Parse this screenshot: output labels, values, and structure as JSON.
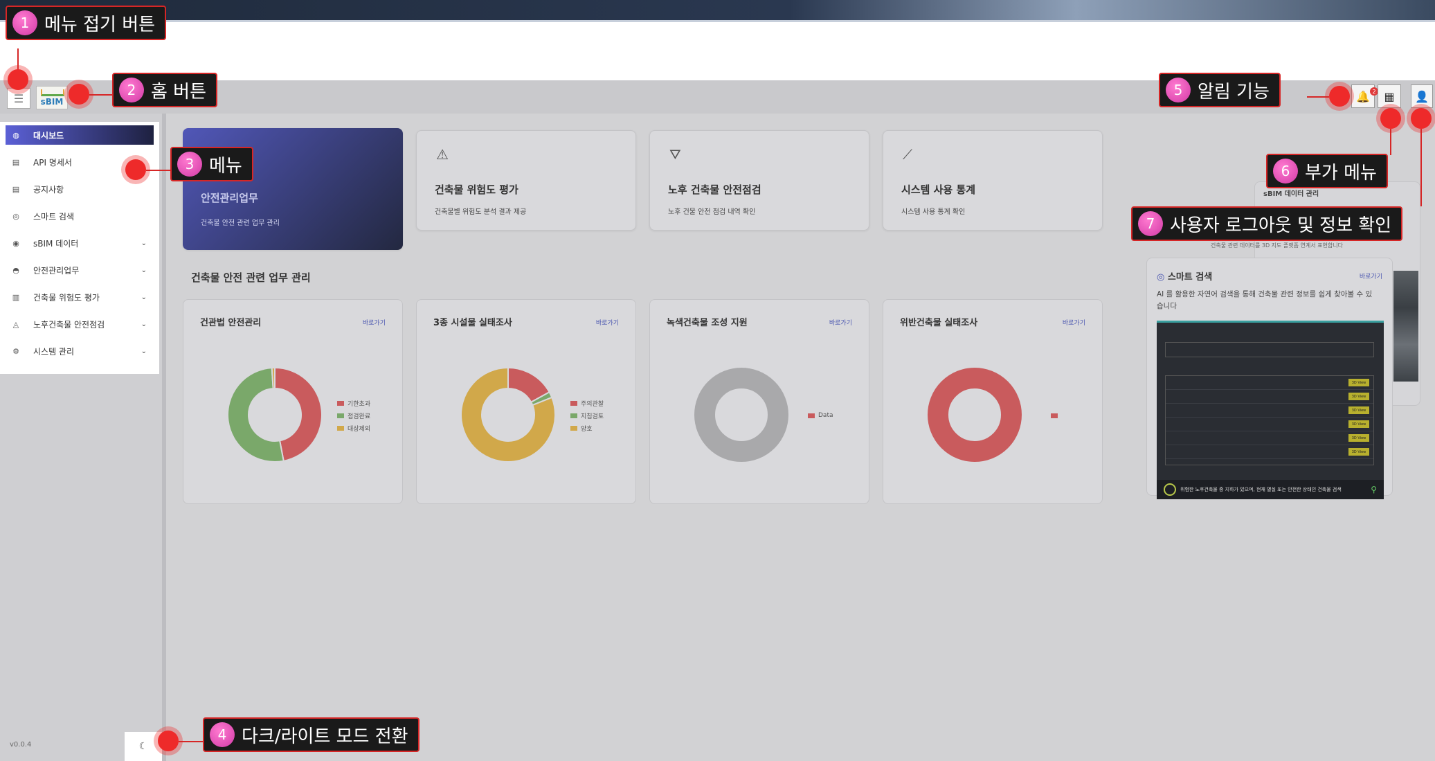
{
  "header": {
    "menu_toggle_glyph": "☰",
    "logo_text": "sBIM",
    "notification_count": "2",
    "grid_glyph": "▦",
    "user_glyph": "👤"
  },
  "sidebar": {
    "items": [
      {
        "label": "대시보드",
        "icon": "dashboard-icon",
        "glyph": "◍"
      },
      {
        "label": "API 명세서",
        "icon": "document-icon",
        "glyph": "▤"
      },
      {
        "label": "공지사항",
        "icon": "notice-icon",
        "glyph": "▤"
      },
      {
        "label": "스마트 검색",
        "icon": "globe-icon",
        "glyph": "◎"
      },
      {
        "label": "sBIM 데이터",
        "icon": "scan-icon",
        "glyph": "◉",
        "chevron": "⌄"
      },
      {
        "label": "안전관리업무",
        "icon": "helmet-icon",
        "glyph": "◓",
        "chevron": "⌄"
      },
      {
        "label": "건축물 위험도 평가",
        "icon": "building-chart-icon",
        "glyph": "▥",
        "chevron": "⌄"
      },
      {
        "label": "노후건축물 안전점검",
        "icon": "inspection-icon",
        "glyph": "◬",
        "chevron": "⌄"
      },
      {
        "label": "시스템 관리",
        "icon": "settings-icon",
        "glyph": "⚙",
        "chevron": "⌄"
      }
    ],
    "version": "v0.0.4",
    "mode_glyph": "☾"
  },
  "cards": [
    {
      "title": "안전관리업무",
      "desc": "건축물 안전 관련 업무 관리",
      "icon": "helmet-icon",
      "glyph": "◓"
    },
    {
      "title": "건축물 위험도 평가",
      "desc": "건축물별 위험도 분석 결과 제공",
      "icon": "warning-icon",
      "glyph": "⚠"
    },
    {
      "title": "노후 건축물 안전점검",
      "desc": "노후 건물 안전 점검 내역 확인",
      "icon": "cone-icon",
      "glyph": "⛛"
    },
    {
      "title": "시스템 사용 통계",
      "desc": "시스템 사용 통계 확인",
      "icon": "line-chart-icon",
      "glyph": "⟋"
    }
  ],
  "section_title": "건축물 안전 관련 업무 관리",
  "link_label": "바로가기",
  "chart_data": [
    {
      "type": "pie",
      "title": "건관법 안전관리",
      "categories": [
        "기한초과",
        "점검완료",
        "대상제외"
      ],
      "values": [
        47,
        52,
        1
      ],
      "colors": [
        "#c95b5d",
        "#7aa86a",
        "#d1a84a"
      ]
    },
    {
      "type": "pie",
      "title": "3종 시설물 실태조사",
      "categories": [
        "주의관찰",
        "지침검토",
        "양호"
      ],
      "values": [
        17,
        2,
        81
      ],
      "colors": [
        "#c95b5d",
        "#7aa86a",
        "#d1a84a"
      ]
    },
    {
      "type": "pie",
      "title": "녹색건축물 조성 지원",
      "categories": [
        "Data"
      ],
      "values": [
        100
      ],
      "colors": [
        "#a9a9ab"
      ],
      "legend_colors": [
        "#c95b5d"
      ]
    },
    {
      "type": "pie",
      "title": "위반건축물 실태조사",
      "categories": [
        ""
      ],
      "values": [
        100
      ],
      "colors": [
        "#c95b5d"
      ]
    }
  ],
  "smart_search": {
    "title": "스마트 검색",
    "link": "바로가기",
    "desc": "AI 를 활용한 자연어 검색을 통해 건축물 관련 정보를 쉽게 찾아볼 수 있습니다",
    "query_bar": "위험한 노후건축물 중 지하가 있으며, 현재 멸실 또는 안전한 상태인 건축물 검색",
    "rows": [
      "row-1",
      "row-2",
      "row-3",
      "row-4",
      "row-5",
      "row-6"
    ],
    "view_label": "3D View",
    "bg_title": "sBIM 데이터 관리",
    "bg_line1": "건축물 관련 데이터를 3D 지도 플랫폼 연계서 표현합니다"
  },
  "annotations": [
    {
      "num": "1",
      "label": "메뉴 접기 버튼"
    },
    {
      "num": "2",
      "label": "홈 버튼"
    },
    {
      "num": "3",
      "label": "메뉴"
    },
    {
      "num": "4",
      "label": "다크/라이트 모드 전환"
    },
    {
      "num": "5",
      "label": "알림 기능"
    },
    {
      "num": "6",
      "label": "부가 메뉴"
    },
    {
      "num": "7",
      "label": "사용자 로그아웃 및 정보 확인"
    }
  ]
}
